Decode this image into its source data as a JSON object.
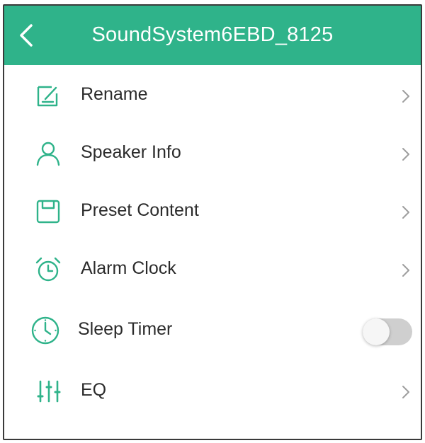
{
  "header": {
    "title": "SoundSystem6EBD_8125",
    "back_icon": "chevron-left-icon"
  },
  "menu": {
    "rename": {
      "label": "Rename",
      "icon": "edit-note-icon"
    },
    "speaker_info": {
      "label": "Speaker Info",
      "icon": "person-icon"
    },
    "preset_content": {
      "label": "Preset Content",
      "icon": "save-icon"
    },
    "alarm_clock": {
      "label": "Alarm Clock",
      "icon": "alarm-clock-icon"
    },
    "sleep_timer": {
      "label": "Sleep Timer",
      "icon": "clock-icon",
      "enabled": false
    },
    "eq": {
      "label": "EQ",
      "icon": "equalizer-sliders-icon"
    }
  },
  "colors": {
    "accent": "#2fb38a",
    "toggle_off_track": "#cfcfcf",
    "chevron": "#9e9e9e",
    "text": "#2b2b2b"
  }
}
